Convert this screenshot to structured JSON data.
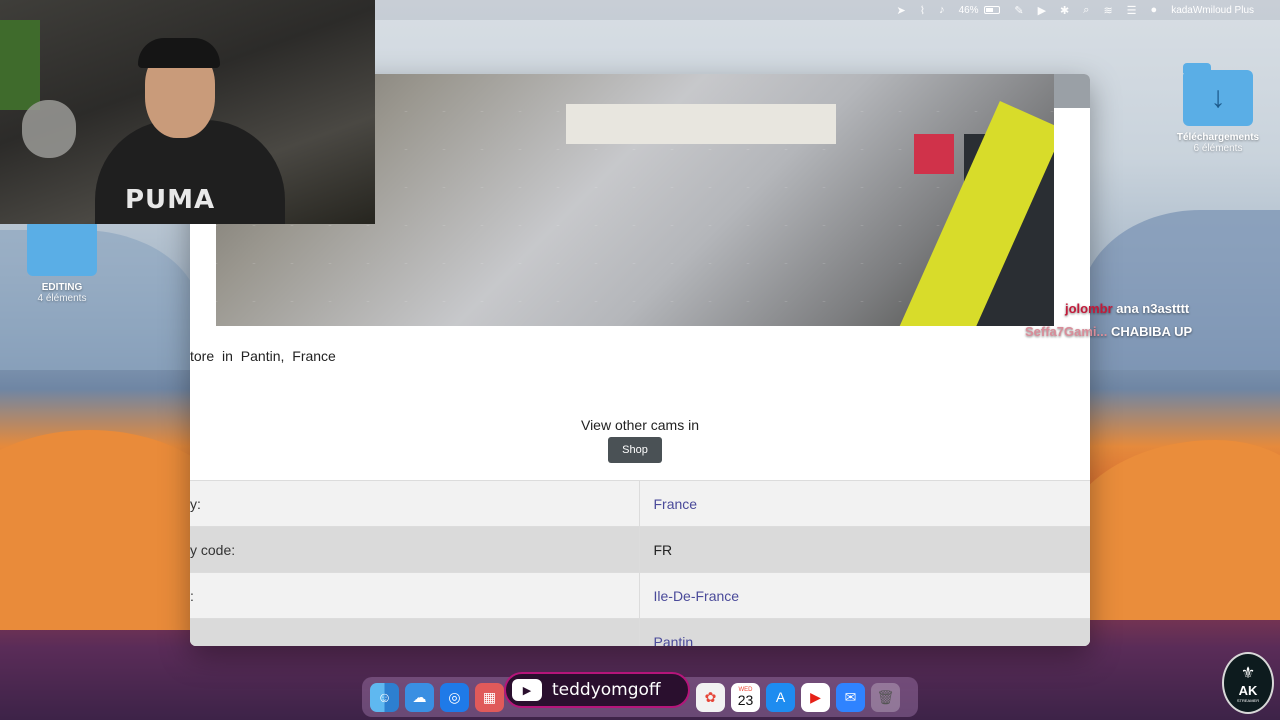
{
  "menubar": {
    "battery": "46%",
    "user": "kadaWmiloud Plus"
  },
  "desktop": {
    "downloads": {
      "name": "Téléchargements",
      "count": "6 éléments"
    },
    "editing": {
      "name": "EDITING",
      "count": "4 éléments"
    }
  },
  "webcam": {
    "shirt_text": "PUMA"
  },
  "page": {
    "caption": "tore  in  Pantin,  France",
    "other_cams": "View other cams in",
    "shop_button": "Shop",
    "rows": [
      {
        "key": "y:",
        "value": "France"
      },
      {
        "key": "y code:",
        "value": "FR"
      },
      {
        "key": ":",
        "value": "Ile-De-France"
      },
      {
        "key": "",
        "value": "Pantin"
      }
    ]
  },
  "chat": [
    {
      "user": "jolombr",
      "message": "ana n3astttt"
    },
    {
      "user": "Seffa7Gami...",
      "message": "CHABIBA UP"
    }
  ],
  "dock": {
    "calendar_month": "WED",
    "calendar_day": "23"
  },
  "stream": {
    "handle": "teddyomgoff"
  },
  "badge": {
    "brand": "AK",
    "sub": "STREAMER"
  },
  "colors": {
    "link": "#4a4a9a",
    "shop_button": "#4a5155",
    "chat_user1": "#c21a3a",
    "chat_user2": "#d98c99",
    "stream_border": "#b5157a"
  }
}
